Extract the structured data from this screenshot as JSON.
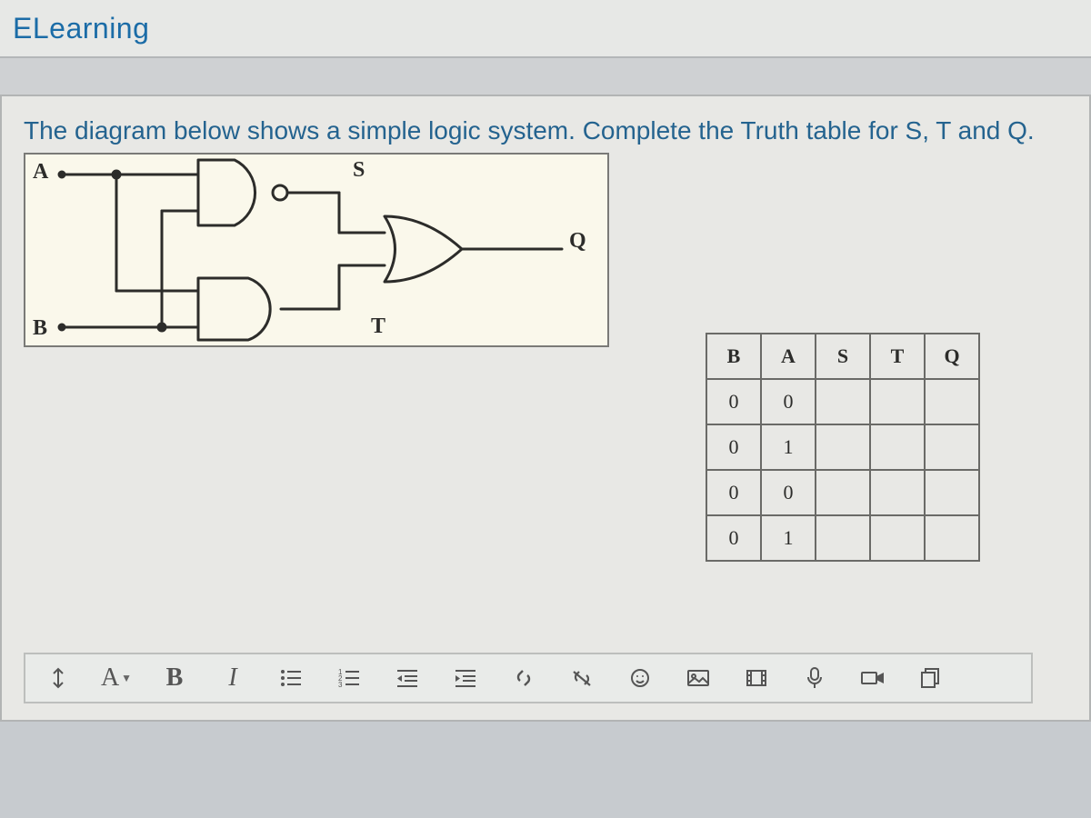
{
  "header": {
    "title": "ELearning"
  },
  "question": {
    "prompt": "The diagram below shows a simple logic system. Complete the Truth table for S, T and Q."
  },
  "diagram": {
    "labels": {
      "A": "A",
      "B": "B",
      "S": "S",
      "T": "T",
      "Q": "Q"
    }
  },
  "truth_table": {
    "headers": [
      "B",
      "A",
      "S",
      "T",
      "Q"
    ],
    "rows": [
      [
        "0",
        "0",
        "",
        "",
        ""
      ],
      [
        "0",
        "1",
        "",
        "",
        ""
      ],
      [
        "0",
        "0",
        "",
        "",
        ""
      ],
      [
        "0",
        "1",
        "",
        "",
        ""
      ]
    ]
  },
  "toolbar": {
    "items": [
      {
        "name": "text-direction-button",
        "label": "↕",
        "interactable": true
      },
      {
        "name": "font-color-button",
        "label": "A",
        "has_caret": true,
        "interactable": true
      },
      {
        "name": "bold-button",
        "label": "B",
        "interactable": true
      },
      {
        "name": "italic-button",
        "label": "I",
        "italic": true,
        "interactable": true
      },
      {
        "name": "bulleted-list-button",
        "icon": "bullet-list",
        "interactable": true
      },
      {
        "name": "numbered-list-button",
        "icon": "numbered-list",
        "interactable": true
      },
      {
        "name": "decrease-indent-button",
        "icon": "outdent",
        "interactable": true
      },
      {
        "name": "increase-indent-button",
        "icon": "indent",
        "interactable": true
      },
      {
        "name": "insert-link-button",
        "icon": "link",
        "interactable": true
      },
      {
        "name": "unlink-button",
        "icon": "unlink",
        "interactable": true
      },
      {
        "name": "insert-emoji-button",
        "icon": "smiley",
        "interactable": true
      },
      {
        "name": "insert-image-button",
        "icon": "image",
        "interactable": true
      },
      {
        "name": "insert-media-button",
        "icon": "film",
        "interactable": true
      },
      {
        "name": "record-audio-button",
        "icon": "mic",
        "interactable": true
      },
      {
        "name": "record-video-button",
        "icon": "camera",
        "interactable": true
      },
      {
        "name": "manage-files-button",
        "icon": "files",
        "interactable": true
      }
    ]
  }
}
